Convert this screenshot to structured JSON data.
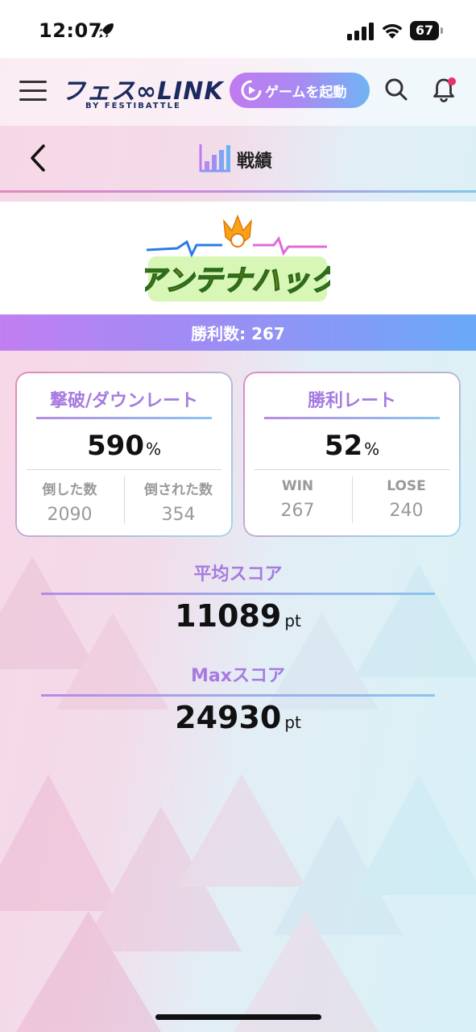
{
  "status_bar": {
    "time": "12:07",
    "battery": "67"
  },
  "header": {
    "logo_main": "フェス∞LINK",
    "logo_sub": "BY FESTIBATTLE",
    "launch_button": "ゲームを起動"
  },
  "page": {
    "title": "戦績"
  },
  "game": {
    "logo_text": "アンテナハック"
  },
  "wins": {
    "label": "勝利数: 267"
  },
  "cards": {
    "kd": {
      "title": "撃破/ダウンレート",
      "value": "590",
      "unit": "%",
      "left_label": "倒した数",
      "left_value": "2090",
      "right_label": "倒された数",
      "right_value": "354"
    },
    "win_rate": {
      "title": "勝利レート",
      "value": "52",
      "unit": "%",
      "left_label": "WIN",
      "left_value": "267",
      "right_label": "LOSE",
      "right_value": "240"
    }
  },
  "scores": {
    "average_label": "平均スコア",
    "average_value": "11089",
    "max_label": "Maxスコア",
    "max_value": "24930",
    "unit": "pt"
  },
  "colors": {
    "accent_purple": "#a67be0",
    "accent_blue": "#6aa9f8",
    "notification_dot": "#e8336b"
  }
}
